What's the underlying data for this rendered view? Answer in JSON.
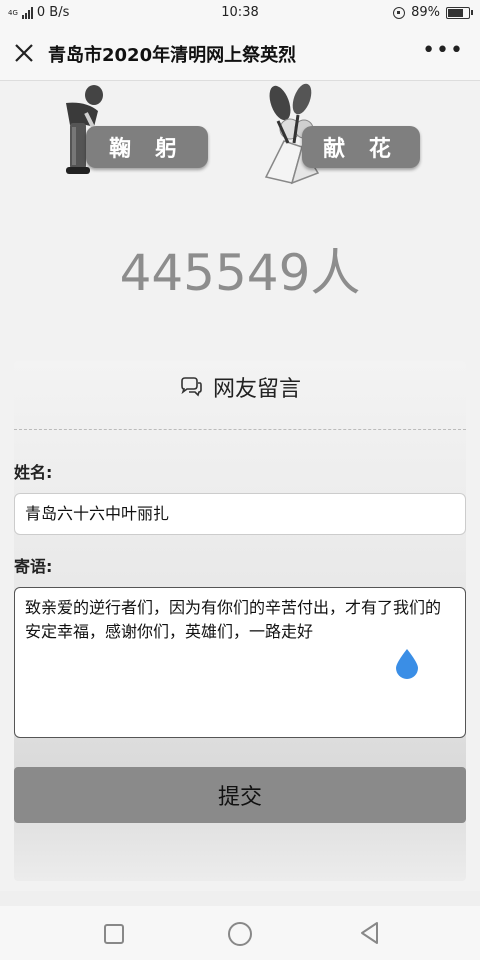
{
  "status_bar": {
    "network_label": "4G",
    "speed": "0 B/s",
    "time": "10:38",
    "battery_percent": "89%",
    "battery_level": 0.89
  },
  "header": {
    "title": "青岛市2020年清明网上祭英烈",
    "close_icon": "close-icon",
    "more_icon": "more-icon"
  },
  "actions": {
    "bow_label": "鞠 躬",
    "flower_label": "献 花"
  },
  "participant_count": "445549人",
  "comments": {
    "section_title": "网友留言",
    "section_icon": "chat-icon",
    "name_label": "姓名:",
    "name_value": "青岛六十六中叶丽扎",
    "message_label": "寄语:",
    "message_value": "致亲爱的逆行者们，因为有你们的辛苦付出，才有了我们的安定幸福，感谢你们，英雄们，一路走好",
    "submit_label": "提交"
  },
  "nav": {
    "recent_icon": "square-icon",
    "home_icon": "circle-icon",
    "back_icon": "back-triangle-icon"
  },
  "colors": {
    "button_gray": "#7f7f7f",
    "counter_gray": "#8d8d8d",
    "drop_blue": "#3a8ee6"
  }
}
